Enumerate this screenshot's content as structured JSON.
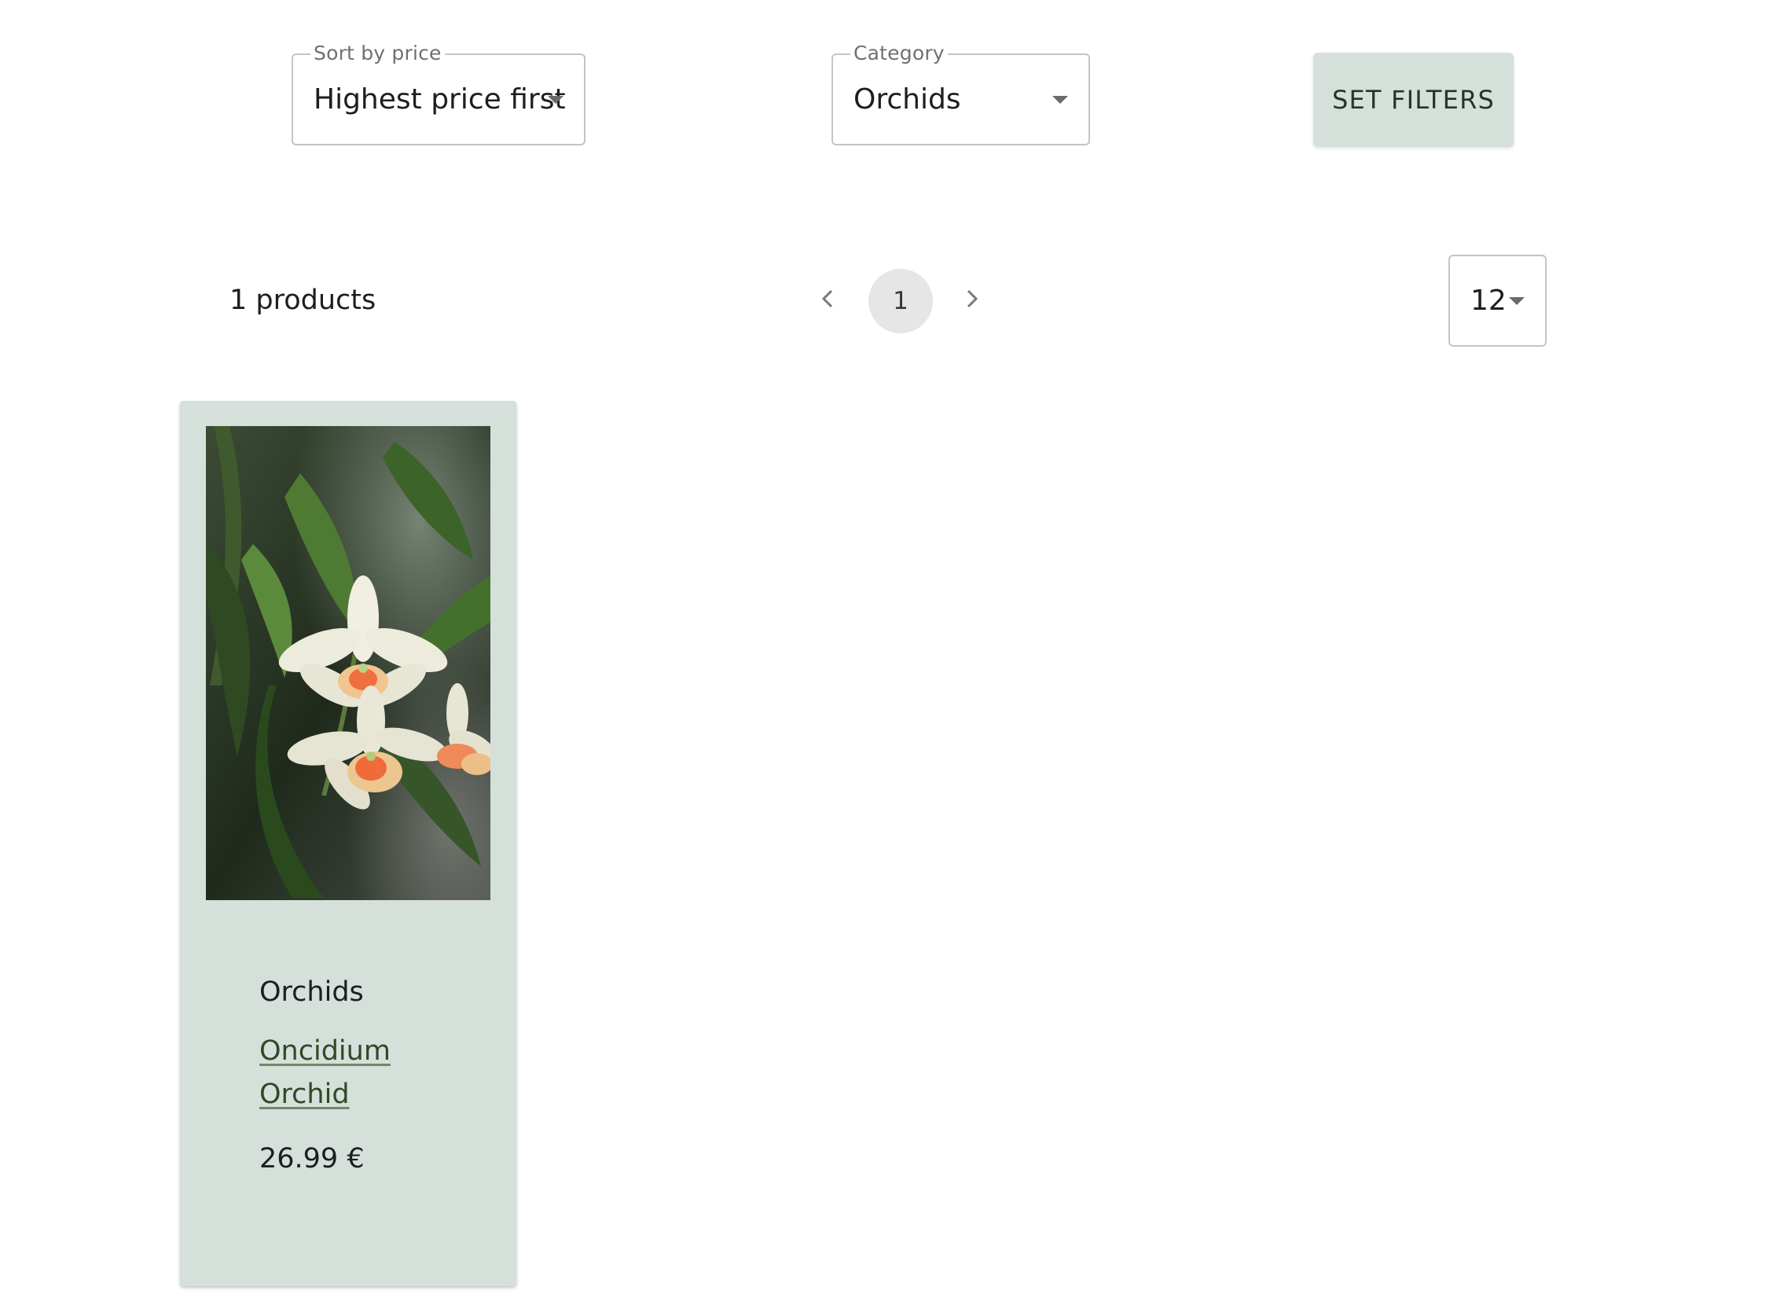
{
  "filters": {
    "sort": {
      "label": "Sort by price",
      "value": "Highest price first"
    },
    "category": {
      "label": "Category",
      "value": "Orchids"
    },
    "submit_label": "SET FILTERS"
  },
  "results": {
    "count_text": "1 products",
    "pagination": {
      "current_page": "1"
    },
    "per_page": "12"
  },
  "products": [
    {
      "category": "Orchids",
      "name": "Oncidium Orchid",
      "price": "26.99 €"
    }
  ],
  "colors": {
    "accent_background": "#d6e0db",
    "button_text": "#213826",
    "link_text": "#2f4a27",
    "page_chip": "#e6e6e6"
  },
  "icons": {
    "prev": "chevron-left-icon",
    "next": "chevron-right-icon",
    "dropdown": "caret-down-icon"
  }
}
